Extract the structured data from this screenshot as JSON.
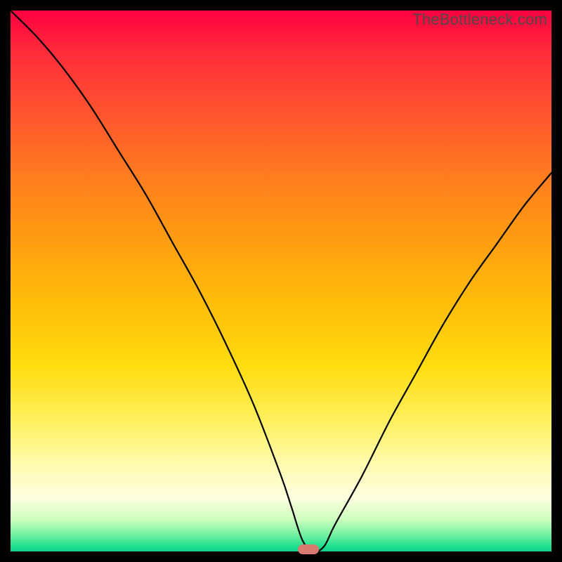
{
  "watermark": "TheBottleneck.com",
  "chart_data": {
    "type": "line",
    "title": "",
    "xlabel": "",
    "ylabel": "",
    "xlim": [
      0,
      100
    ],
    "ylim": [
      0,
      100
    ],
    "grid": false,
    "legend": false,
    "series": [
      {
        "name": "bottleneck-curve",
        "x": [
          0,
          5,
          10,
          15,
          20,
          25,
          30,
          35,
          40,
          45,
          50,
          52,
          54,
          56,
          58,
          60,
          65,
          70,
          75,
          80,
          85,
          90,
          95,
          100
        ],
        "values": [
          100,
          95,
          89,
          82,
          74,
          66,
          57,
          48,
          38,
          27,
          14,
          8,
          2,
          0,
          1,
          5,
          14,
          24,
          33,
          42,
          50,
          57,
          64,
          70
        ]
      }
    ],
    "annotations": [
      {
        "name": "optimal-marker",
        "x": 55,
        "y": 0,
        "color": "#d87a6f"
      }
    ],
    "background_gradient": {
      "top": "#ff0040",
      "mid": "#ffdd10",
      "bottom": "#10d090"
    }
  }
}
